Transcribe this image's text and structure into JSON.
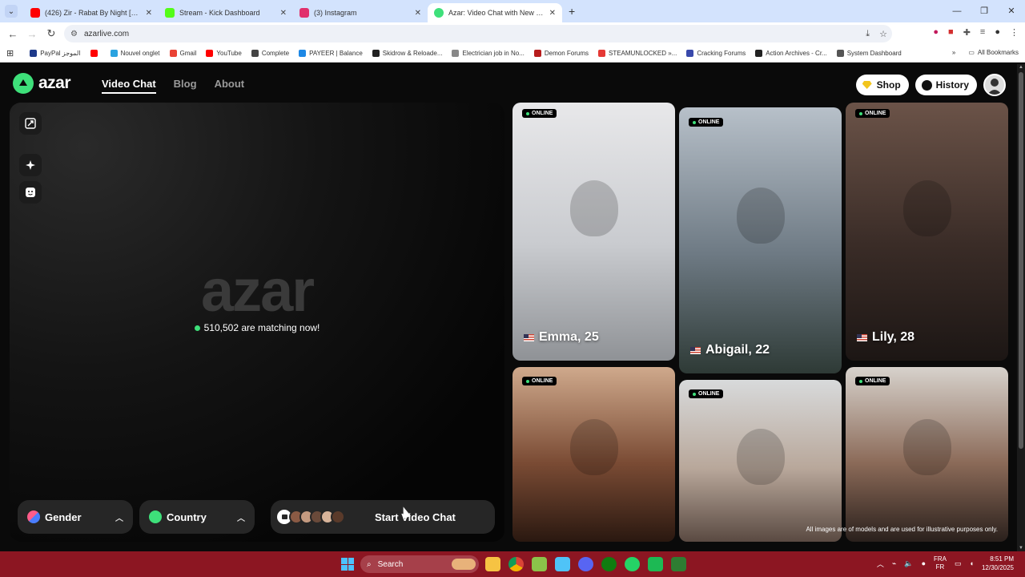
{
  "browser": {
    "tabs": [
      {
        "title": "(426) Zir - Rabat By Night [Prod",
        "favicon_color": "#ff0000",
        "active": false
      },
      {
        "title": "Stream - Kick Dashboard",
        "favicon_color": "#53fc18",
        "active": false
      },
      {
        "title": "(3) Instagram",
        "favicon_color": "#e1306c",
        "active": false
      },
      {
        "title": "Azar: Video Chat with New Peo",
        "favicon_color": "#3ee07a",
        "active": true
      }
    ],
    "new_tab_glyph": "+",
    "url": "azarlive.com",
    "bookmarks": [
      {
        "label": "PayPal الموجز",
        "color": "#1e3a8a"
      },
      {
        "label": "",
        "color": "#ff0000"
      },
      {
        "label": "Nouvel onglet",
        "color": "#2aa3e0"
      },
      {
        "label": "Gmail",
        "color": "#ea4335"
      },
      {
        "label": "YouTube",
        "color": "#ff0000"
      },
      {
        "label": "Complete",
        "color": "#444444"
      },
      {
        "label": "PAYEER | Balance",
        "color": "#1e88e5"
      },
      {
        "label": "Skidrow & Reloade...",
        "color": "#222222"
      },
      {
        "label": "Electrician job in No...",
        "color": "#888888"
      },
      {
        "label": "Demon Forums",
        "color": "#b71c1c"
      },
      {
        "label": "STEAMUNLOCKED »...",
        "color": "#e53935"
      },
      {
        "label": "Cracking Forums",
        "color": "#3949ab"
      },
      {
        "label": "Action Archives - Cr...",
        "color": "#222222"
      },
      {
        "label": "System Dashboard",
        "color": "#555555"
      }
    ],
    "all_bookmarks": "All Bookmarks"
  },
  "site": {
    "logo": "azar",
    "nav": [
      "Video Chat",
      "Blog",
      "About"
    ],
    "shop": "Shop",
    "history": "History",
    "watermark": "azar",
    "matching_text": "510,502 are matching now!",
    "gender": "Gender",
    "country": "Country",
    "start": "Start Video Chat",
    "online_label": "ONLINE",
    "disclaimer": "All images are of models and are used for illustrative purposes only.",
    "profiles": [
      {
        "name": "Emma, 25",
        "colors": [
          "#e8e8ea",
          "#c9cbcf",
          "#8f9296"
        ]
      },
      {
        "name": "Abigail, 22",
        "colors": [
          "#b7c0c9",
          "#6e7a84",
          "#2e3a36"
        ]
      },
      {
        "name": "Lily, 28",
        "colors": [
          "#6b5348",
          "#3a2c27",
          "#1c1614"
        ]
      },
      {
        "name": "",
        "colors": [
          "#cfa98c",
          "#7a4b34",
          "#2a1810"
        ]
      },
      {
        "name": "",
        "colors": [
          "#d8dadb",
          "#b8a79a",
          "#5a4a42"
        ]
      },
      {
        "name": "",
        "colors": [
          "#d7d2cc",
          "#8b6a58",
          "#2a201c"
        ]
      }
    ]
  },
  "taskbar": {
    "search": "Search",
    "lang_top": "FRA",
    "lang_bottom": "FR",
    "time": "8:51 PM",
    "date": "12/30/2025"
  }
}
